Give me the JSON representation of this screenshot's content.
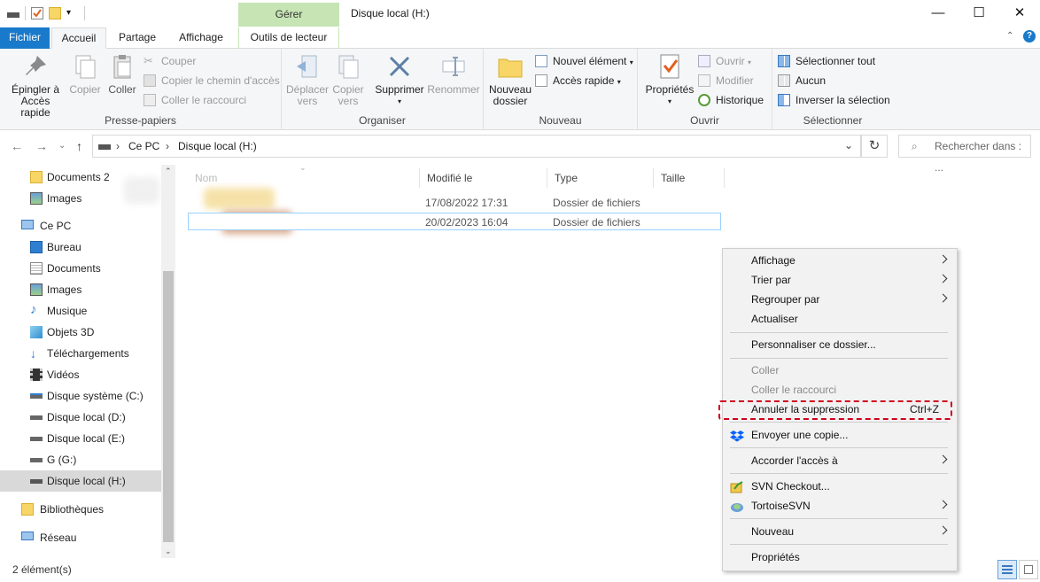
{
  "window": {
    "title": "Disque local (H:)",
    "tool_group": "Gérer",
    "controls": {
      "minimize": "—",
      "maximize": "☐",
      "close": "✕"
    }
  },
  "tabs": {
    "file": "Fichier",
    "home": "Accueil",
    "share": "Partage",
    "view": "Affichage",
    "drive_tools": "Outils de lecteur"
  },
  "ribbon": {
    "clipboard": {
      "label": "Presse-papiers",
      "pin_line1": "Épingler à",
      "pin_line2": "Accès rapide",
      "copy": "Copier",
      "paste": "Coller",
      "cut": "Couper",
      "copy_path": "Copier le chemin d'accès",
      "paste_shortcut": "Coller le raccourci"
    },
    "organize": {
      "label": "Organiser",
      "move_line1": "Déplacer",
      "move_line2": "vers",
      "copyto_line1": "Copier",
      "copyto_line2": "vers",
      "delete": "Supprimer",
      "rename": "Renommer"
    },
    "new": {
      "label": "Nouveau",
      "new_folder_line1": "Nouveau",
      "new_folder_line2": "dossier",
      "new_item": "Nouvel élément",
      "easy_access": "Accès rapide"
    },
    "open": {
      "label": "Ouvrir",
      "properties": "Propriétés",
      "open": "Ouvrir",
      "edit": "Modifier",
      "history": "Historique"
    },
    "select": {
      "label": "Sélectionner",
      "select_all": "Sélectionner tout",
      "select_none": "Aucun",
      "invert": "Inverser la sélection"
    }
  },
  "address": {
    "root": "Ce PC",
    "current": "Disque local (H:)",
    "search_placeholder": "Rechercher dans : ..."
  },
  "nav": {
    "items": [
      {
        "label": "Documents 2",
        "icon": "folder-icon"
      },
      {
        "label": "Images",
        "icon": "pictures-icon"
      },
      {
        "label": "Ce PC",
        "icon": "computer-icon"
      },
      {
        "label": "Bureau",
        "icon": "desktop-icon"
      },
      {
        "label": "Documents",
        "icon": "documents-icon"
      },
      {
        "label": "Images",
        "icon": "pictures-icon"
      },
      {
        "label": "Musique",
        "icon": "music-icon"
      },
      {
        "label": "Objets 3D",
        "icon": "objects-3d-icon"
      },
      {
        "label": "Téléchargements",
        "icon": "downloads-icon"
      },
      {
        "label": "Vidéos",
        "icon": "videos-icon"
      },
      {
        "label": "Disque système (C:)",
        "icon": "system-drive-icon"
      },
      {
        "label": "Disque local (D:)",
        "icon": "drive-icon"
      },
      {
        "label": "Disque local (E:)",
        "icon": "drive-icon"
      },
      {
        "label": "G (G:)",
        "icon": "drive-icon"
      },
      {
        "label": "Disque local (H:)",
        "icon": "drive-icon"
      },
      {
        "label": "Bibliothèques",
        "icon": "libraries-icon"
      },
      {
        "label": "Réseau",
        "icon": "network-icon"
      }
    ]
  },
  "columns": {
    "name": "Nom",
    "modified": "Modifié le",
    "type": "Type",
    "size": "Taille"
  },
  "files": [
    {
      "modified": "17/08/2022 17:31",
      "type": "Dossier de fichiers"
    },
    {
      "modified": "20/02/2023 16:04",
      "type": "Dossier de fichiers"
    }
  ],
  "status": {
    "count": "2 élément(s)"
  },
  "context_menu": {
    "view": "Affichage",
    "sort_by": "Trier par",
    "group_by": "Regrouper par",
    "refresh": "Actualiser",
    "customize": "Personnaliser ce dossier...",
    "paste": "Coller",
    "paste_shortcut": "Coller le raccourci",
    "undo_delete": "Annuler la suppression",
    "undo_shortcut": "Ctrl+Z",
    "send_copy": "Envoyer une copie...",
    "give_access": "Accorder l'accès à",
    "svn_checkout": "SVN Checkout...",
    "tortoise": "TortoiseSVN",
    "new": "Nouveau",
    "properties": "Propriétés"
  },
  "colors": {
    "accent": "#1979ca",
    "tool_tab": "#c6e4b4",
    "highlight_border": "#d0021b",
    "selection": "#99d1ff"
  }
}
